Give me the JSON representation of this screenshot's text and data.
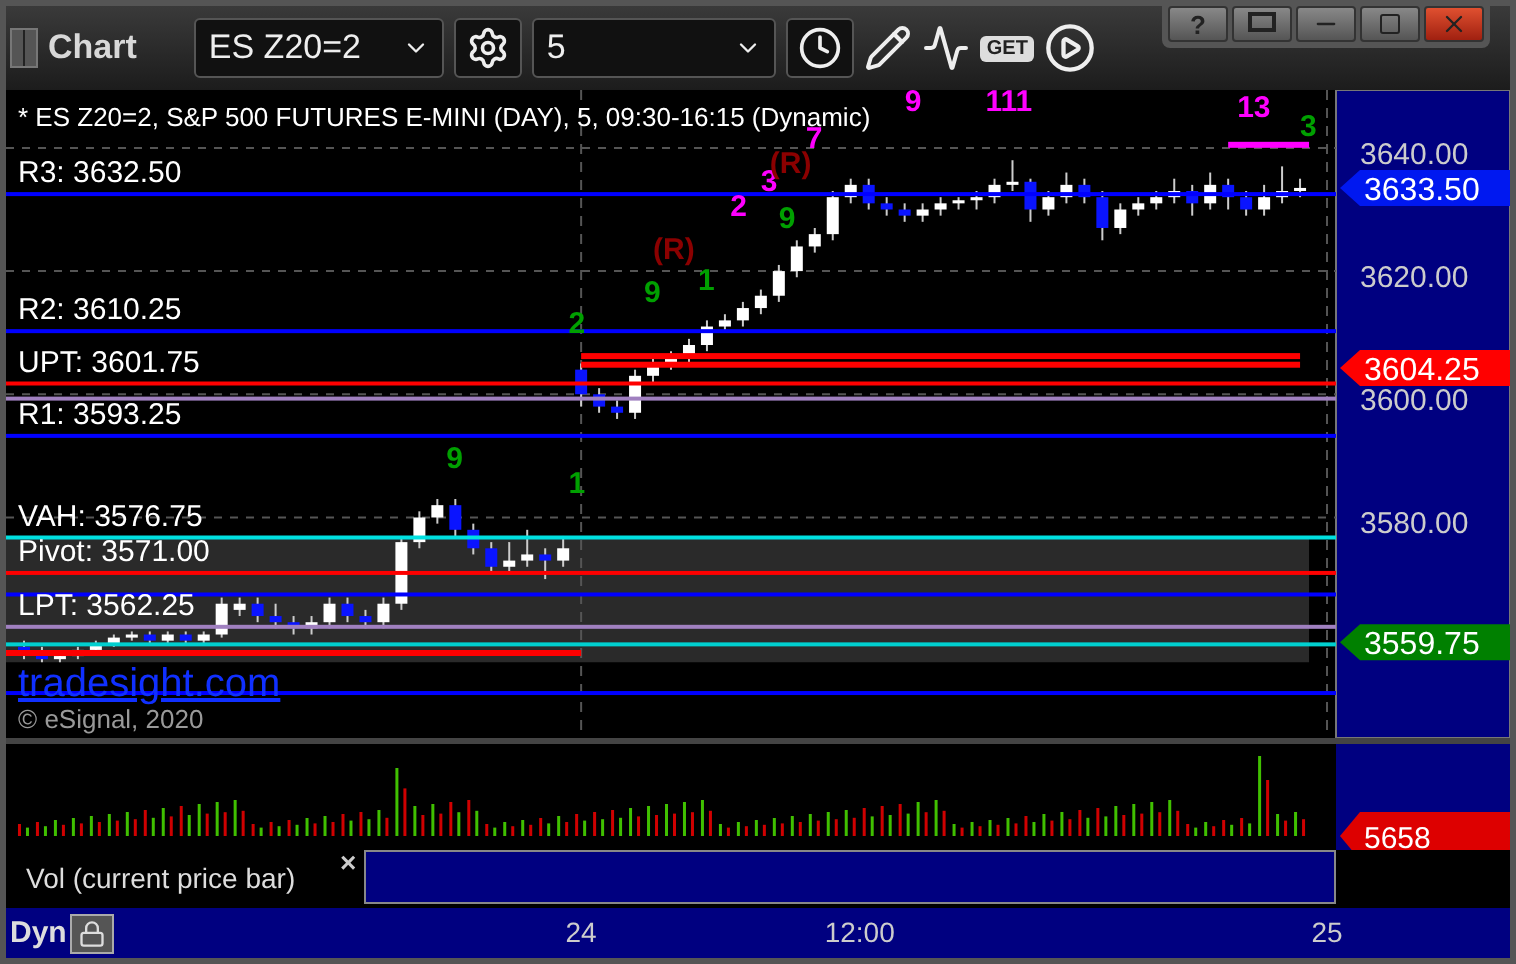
{
  "window": {
    "title": "Chart",
    "help": "?"
  },
  "toolbar": {
    "symbol": "ES Z20=2",
    "interval": "5",
    "get_label": "GET"
  },
  "chart": {
    "title": "* ES Z20=2, S&P 500 FUTURES E-MINI (DAY), 5, 09:30-16:15 (Dynamic)",
    "link": "tradesight.com",
    "copyright": "© eSignal, 2020",
    "chart_data": {
      "type": "candlestick",
      "grid": true,
      "ylim": [
        3544.2,
        3649.4
      ],
      "ohlc": [
        [
          3559,
          3560,
          3557,
          3558
        ],
        [
          3558,
          3559,
          3556.5,
          3557
        ],
        [
          3557,
          3558,
          3556.5,
          3557.5
        ],
        [
          3557.5,
          3559,
          3557,
          3558.5
        ],
        [
          3558.5,
          3560,
          3558,
          3559.5
        ],
        [
          3559.5,
          3561,
          3559,
          3560.5
        ],
        [
          3560.5,
          3561.5,
          3560,
          3561
        ],
        [
          3561,
          3561.5,
          3559.5,
          3560
        ],
        [
          3560,
          3561.5,
          3559.5,
          3561
        ],
        [
          3561,
          3561.5,
          3559.5,
          3560
        ],
        [
          3560,
          3561.5,
          3559.5,
          3561
        ],
        [
          3561,
          3567,
          3560.5,
          3566
        ],
        [
          3565,
          3567,
          3564,
          3566
        ],
        [
          3566,
          3567,
          3563,
          3564
        ],
        [
          3564,
          3566,
          3562,
          3563
        ],
        [
          3563,
          3564,
          3561,
          3562
        ],
        [
          3562,
          3564,
          3561,
          3563
        ],
        [
          3563,
          3567,
          3562,
          3566
        ],
        [
          3566,
          3567,
          3563,
          3564
        ],
        [
          3564,
          3565,
          3562,
          3563
        ],
        [
          3563,
          3567,
          3562,
          3566
        ],
        [
          3566,
          3577,
          3565,
          3576
        ],
        [
          3576,
          3581,
          3575,
          3580
        ],
        [
          3580,
          3583,
          3579,
          3582
        ],
        [
          3582,
          3583,
          3577,
          3578
        ],
        [
          3578,
          3579,
          3574,
          3575
        ],
        [
          3575,
          3576,
          3571,
          3572
        ],
        [
          3572,
          3576,
          3571,
          3573
        ],
        [
          3573,
          3578,
          3572,
          3574
        ],
        [
          3574,
          3575,
          3570,
          3573
        ],
        [
          3573,
          3577,
          3572,
          3575
        ],
        [
          3604,
          3605,
          3598,
          3600
        ],
        [
          3600,
          3601,
          3597,
          3598
        ],
        [
          3598,
          3599,
          3596,
          3597
        ],
        [
          3597,
          3604,
          3596,
          3603
        ],
        [
          3603,
          3606,
          3602,
          3605
        ],
        [
          3605,
          3607,
          3604,
          3606
        ],
        [
          3606,
          3609,
          3605,
          3608
        ],
        [
          3608,
          3612,
          3607,
          3611
        ],
        [
          3611,
          3613,
          3610,
          3612
        ],
        [
          3612,
          3615,
          3611,
          3614
        ],
        [
          3614,
          3617,
          3613,
          3616
        ],
        [
          3616,
          3621,
          3615,
          3620
        ],
        [
          3620,
          3625,
          3619,
          3624
        ],
        [
          3624,
          3627,
          3623,
          3626
        ],
        [
          3626,
          3633,
          3625,
          3632
        ],
        [
          3632,
          3635,
          3631,
          3634
        ],
        [
          3634,
          3635,
          3630,
          3631
        ],
        [
          3631,
          3632,
          3629,
          3630
        ],
        [
          3630,
          3631,
          3628,
          3629
        ],
        [
          3629,
          3631,
          3628,
          3630
        ],
        [
          3630,
          3632,
          3629,
          3631
        ],
        [
          3631,
          3632,
          3630,
          3631.5
        ],
        [
          3631.5,
          3633,
          3630,
          3632
        ],
        [
          3632,
          3635,
          3631,
          3634
        ],
        [
          3634,
          3638,
          3633,
          3634.5
        ],
        [
          3634.5,
          3635,
          3628,
          3630
        ],
        [
          3630,
          3633,
          3629,
          3632
        ],
        [
          3632,
          3636,
          3631,
          3634
        ],
        [
          3634,
          3635,
          3631,
          3632
        ],
        [
          3632,
          3633,
          3625,
          3627
        ],
        [
          3627,
          3631,
          3626,
          3630
        ],
        [
          3630,
          3632,
          3629,
          3631
        ],
        [
          3631,
          3633,
          3630,
          3632
        ],
        [
          3632,
          3635,
          3631,
          3633
        ],
        [
          3633,
          3634,
          3629,
          3631
        ],
        [
          3631,
          3636,
          3630,
          3634
        ],
        [
          3634,
          3635,
          3630,
          3632
        ],
        [
          3632,
          3633,
          3629,
          3630
        ],
        [
          3630,
          3634,
          3629,
          3632
        ],
        [
          3632,
          3637,
          3631,
          3633
        ],
        [
          3633,
          3635,
          3632,
          3633.5
        ]
      ],
      "yticks": [
        {
          "value": 3640,
          "label": "3640.00"
        },
        {
          "value": 3620,
          "label": "3620.00"
        },
        {
          "value": 3600,
          "label": "3600.00"
        },
        {
          "value": 3580,
          "label": "3580.00"
        }
      ]
    },
    "levels": [
      {
        "color": "#0000ff",
        "label": "R3: 3632.50"
      },
      {
        "color": "#0000ff",
        "label": "R2: 3610.25"
      },
      {
        "color": "#ff0000",
        "label": "UPT: 3601.75"
      },
      {
        "color": "#a080c0"
      },
      {
        "color": "#0000ff",
        "label": "R1: 3593.25"
      },
      {
        "color": "#00e0e0",
        "label": "VAH: 3576.75"
      },
      {
        "color": "#ff0000",
        "label": "Pivot: 3571.00"
      },
      {
        "color": "#0000ff"
      },
      {
        "color": "#a080c0",
        "label": "LPT: 3562.25"
      },
      {
        "color": "#00d0d0"
      },
      {
        "color": "#0000ff"
      },
      {
        "color": "#ff0000"
      },
      {
        "color": "#ff0000"
      },
      {
        "color": "#ff0000"
      },
      {
        "color": "#ff00ff"
      }
    ],
    "study_labels": [
      {
        "text": "1",
        "color": "#00a000"
      },
      {
        "text": "2",
        "color": "#00a000"
      },
      {
        "text": "9",
        "color": "#00a000"
      },
      {
        "text": "1",
        "color": "#00a000"
      },
      {
        "text": "9",
        "color": "#00a000"
      },
      {
        "text": "9",
        "color": "#00a000"
      },
      {
        "text": "3",
        "color": "#00a000"
      },
      {
        "text": "2",
        "color": "#ff00ff"
      },
      {
        "text": "3",
        "color": "#ff00ff"
      },
      {
        "text": "7",
        "color": "#ff00ff"
      },
      {
        "text": "9",
        "color": "#ff00ff"
      },
      {
        "text": "111",
        "color": "#ff00ff"
      },
      {
        "text": "13",
        "color": "#ff00ff"
      },
      {
        "text": "(R)",
        "color": "#8b0000"
      },
      {
        "text": "(R)",
        "color": "#8b0000"
      }
    ],
    "price_markers": [
      {
        "text": "3633.50",
        "color": "#0018f0"
      },
      {
        "text": "3604.25",
        "color": "#ff0000"
      },
      {
        "text": "3559.75",
        "color": "#008000"
      }
    ]
  },
  "volume": {
    "label": "Vol (current price bar)",
    "close": "×",
    "reading": "5658"
  },
  "status_bar": {
    "mode": "Dyn",
    "time_ticks": [
      "24",
      "12:00",
      "25"
    ]
  }
}
